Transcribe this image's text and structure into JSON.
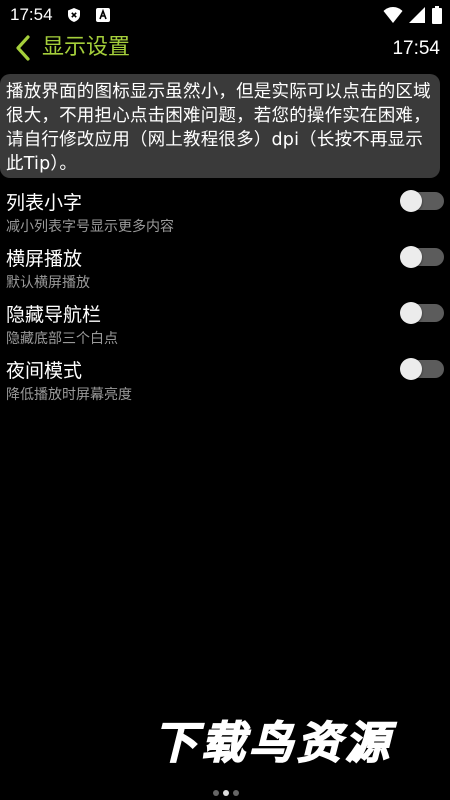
{
  "status_bar": {
    "time": "17:54",
    "icons": [
      "shield-x-icon",
      "text-a-icon",
      "wifi-icon",
      "signal-icon",
      "battery-icon"
    ]
  },
  "app_bar": {
    "title": "显示设置",
    "clock": "17:54",
    "accent_color": "#a5cf3b"
  },
  "tip": {
    "text": "播放界面的图标显示虽然小，但是实际可以点击的区域很大，不用担心点击困难问题，若您的操作实在困难，请自行修改应用（网上教程很多）dpi（长按不再显示此Tip）。"
  },
  "settings": [
    {
      "title": "列表小字",
      "subtitle": "减小列表字号显示更多内容",
      "enabled": false
    },
    {
      "title": "横屏播放",
      "subtitle": "默认横屏播放",
      "enabled": false
    },
    {
      "title": "隐藏导航栏",
      "subtitle": "隐藏底部三个白点",
      "enabled": false
    },
    {
      "title": "夜间模式",
      "subtitle": "降低播放时屏幕亮度",
      "enabled": false
    }
  ],
  "watermark": {
    "text": "下载鸟资源"
  },
  "page_indicator": {
    "count": 3,
    "active_index": 1
  }
}
